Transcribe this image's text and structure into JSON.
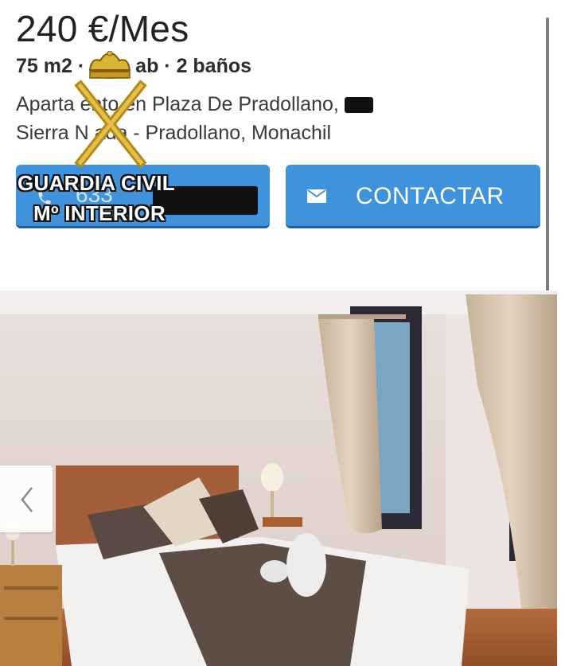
{
  "listing": {
    "price": "240 €/Mes",
    "details_area": "75 m2 ·",
    "details_rooms": "ab · 2 baños",
    "address_line1": "Aparta   ento en Plaza De Pradollano,",
    "address_line2": "Sierra N   ada - Pradollano, Monachil"
  },
  "actions": {
    "call_number": "633",
    "contact_label": "CONTACTAR",
    "accent_color": "#3f93dd"
  },
  "watermark": {
    "line1": "GUARDIA CIVIL",
    "line2": "Mº INTERIOR"
  },
  "gallery": {
    "prev_icon": "chevron-left-icon"
  }
}
